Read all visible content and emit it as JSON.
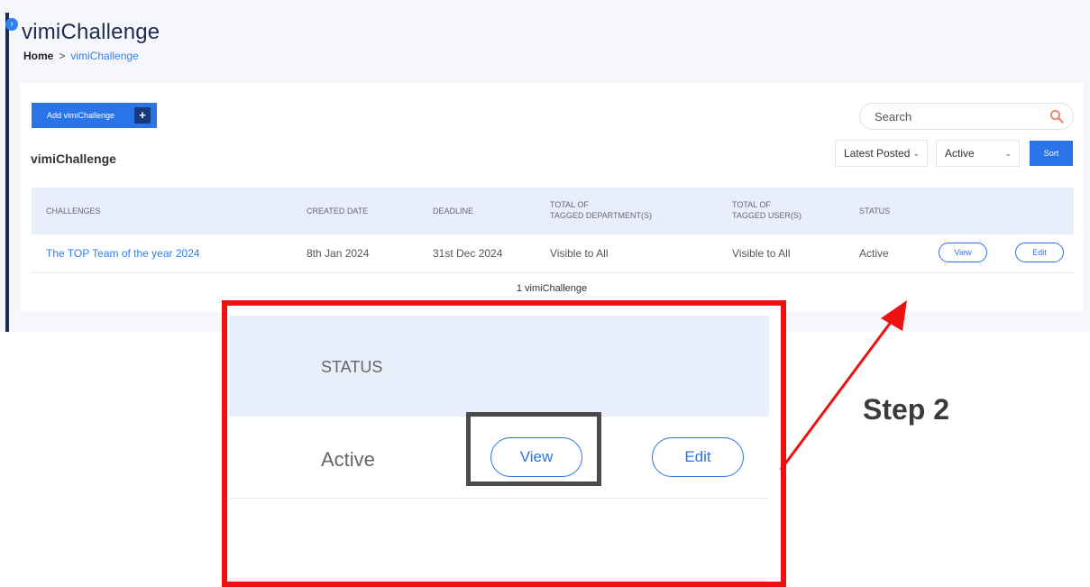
{
  "page": {
    "title": "vimiChallenge",
    "breadcrumb": {
      "home": "Home",
      "separator": ">",
      "current": "vimiChallenge"
    }
  },
  "toolbar": {
    "add_label": "Add vimiChallenge",
    "add_icon": "+",
    "section_title": "vimiChallenge",
    "search_placeholder": "Search",
    "sort_options": {
      "selected": "Latest Posted"
    },
    "status_filter": {
      "selected": "Active"
    },
    "sort_label": "Sort"
  },
  "table": {
    "headers": {
      "challenges": "CHALLENGES",
      "created": "CREATED DATE",
      "deadline": "DEADLINE",
      "dept": [
        "TOTAL OF",
        "TAGGED DEPARTMENT(S)"
      ],
      "users": [
        "TOTAL OF",
        "TAGGED USER(S)"
      ],
      "status": "STATUS"
    },
    "rows": [
      {
        "challenge": "The TOP Team of the year 2024",
        "created": "8th Jan 2024",
        "deadline": "31st Dec 2024",
        "departments": "Visible to All",
        "users": "Visible to All",
        "status": "Active",
        "view_label": "View",
        "edit_label": "Edit"
      }
    ],
    "count_text": "1 vimiChallenge"
  },
  "callout": {
    "status_header": "STATUS",
    "status_value": "Active",
    "view_label": "View",
    "edit_label": "Edit",
    "step_label": "Step 2"
  },
  "colors": {
    "primary": "#2a73e8",
    "callout_border": "#ee1111",
    "highlight_border": "#4a4a4a",
    "header_bg": "#e8effb"
  }
}
